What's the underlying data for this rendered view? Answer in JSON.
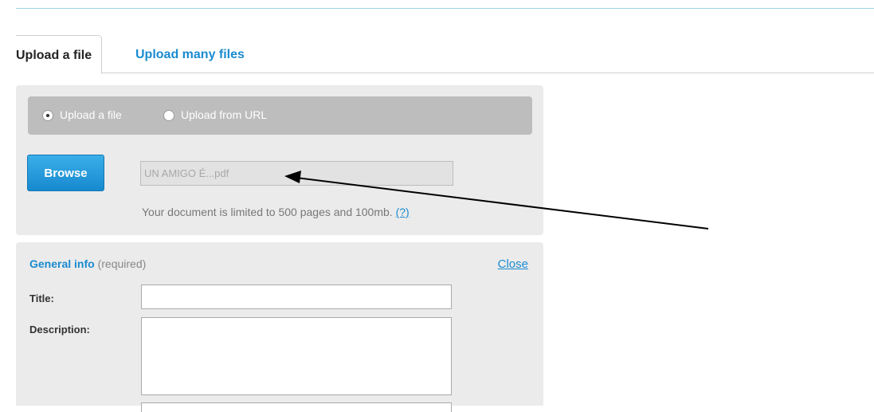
{
  "tabs": [
    {
      "label": "Upload a file",
      "active": true
    },
    {
      "label": "Upload many files",
      "active": false
    }
  ],
  "upload": {
    "options": [
      {
        "label": "Upload a file",
        "selected": true
      },
      {
        "label": "Upload from URL",
        "selected": false
      }
    ],
    "browse_label": "Browse",
    "file_value": "UN AMIGO É...pdf",
    "limit_text": "Your document is limited to 500 pages and 100mb.",
    "help_link": "(?)"
  },
  "general_info": {
    "heading": "General info",
    "required_note": "(required)",
    "close_label": "Close",
    "title_label": "Title:",
    "title_value": "",
    "description_label": "Description:",
    "description_value": ""
  },
  "colors": {
    "accent": "#1a8bd0",
    "button": "#2a9de0",
    "panel": "#ebebeb",
    "radio_bar": "#bdbdbd"
  },
  "annotation": {
    "type": "arrow",
    "icon": "arrow-icon",
    "points_to": "file-name-field"
  }
}
